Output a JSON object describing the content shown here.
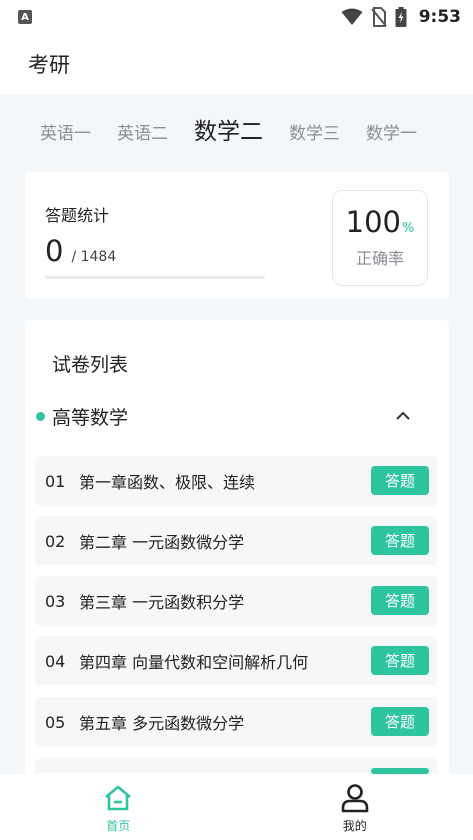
{
  "status_bar": {
    "time": "9:53",
    "notification_letter": "A"
  },
  "header": {
    "title": "考研"
  },
  "tabs": [
    {
      "label": "英语一"
    },
    {
      "label": "英语二"
    },
    {
      "label": "数学二"
    },
    {
      "label": "数学三"
    },
    {
      "label": "数学一"
    }
  ],
  "stats": {
    "label": "答题统计",
    "answered": "0",
    "total": "/ 1484",
    "progress_fraction": 0,
    "accuracy": "100",
    "accuracy_unit": "%",
    "accuracy_label": "正确率"
  },
  "papers": {
    "title": "试卷列表",
    "group": "高等数学",
    "items": [
      {
        "num": "01",
        "name": "第一章函数、极限、连续",
        "action": "答题"
      },
      {
        "num": "02",
        "name": "第二章 一元函数微分学",
        "action": "答题"
      },
      {
        "num": "03",
        "name": "第三章 一元函数积分学",
        "action": "答题"
      },
      {
        "num": "04",
        "name": "第四章 向量代数和空间解析几何",
        "action": "答题"
      },
      {
        "num": "05",
        "name": "第五章 多元函数微分学",
        "action": "答题"
      },
      {
        "num": "",
        "name": "",
        "action": ""
      }
    ]
  },
  "nav": [
    {
      "label": "首页",
      "icon": "home-icon"
    },
    {
      "label": "我的",
      "icon": "user-icon"
    }
  ],
  "colors": {
    "accent": "#2ec4a0",
    "background": "#f4f7fa"
  }
}
